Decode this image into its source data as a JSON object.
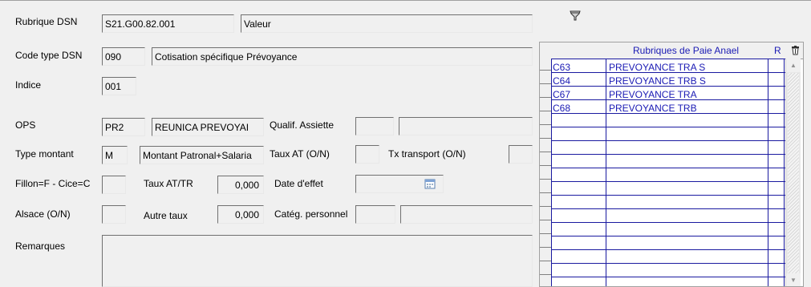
{
  "form": {
    "rubrique_dsn_label": "Rubrique DSN",
    "rubrique_dsn_value": "S21.G00.82.001",
    "valeur_value": "Valeur",
    "code_type_label": "Code type DSN",
    "code_type_value": "090",
    "code_type_desc": "Cotisation spécifique Prévoyance",
    "indice_label": "Indice",
    "indice_value": "001",
    "ops_label": "OPS",
    "ops_value": "PR2",
    "ops_desc": "REUNICA PREVOYAI",
    "qualif_label": "Qualif. Assiette",
    "qualif_value": "",
    "qualif_desc": "",
    "type_montant_label": "Type montant",
    "type_montant_value": "M",
    "type_montant_desc": "Montant Patronal+Salaria",
    "taux_at_label": "Taux AT (O/N)",
    "taux_at_value": "",
    "tx_transport_label": "Tx transport (O/N)",
    "tx_transport_value": "",
    "fillon_label": "Fillon=F - Cice=C",
    "fillon_value": "",
    "taux_at_tr_label": "Taux AT/TR",
    "taux_at_tr_value": "0,000",
    "date_effet_label": "Date d'effet",
    "date_effet_value": "",
    "alsace_label": "Alsace (O/N)",
    "alsace_value": "",
    "autre_taux_label": "Autre taux",
    "autre_taux_value": "0,000",
    "categ_label": "Catég. personnel",
    "categ_value": "",
    "categ_desc": "",
    "remarques_label": "Remarques",
    "remarques_value": ""
  },
  "grid": {
    "header_title": "Rubriques de Paie Anael",
    "header_r": "R",
    "rows": [
      {
        "code": "C63",
        "label": "PREVOYANCE TRA S"
      },
      {
        "code": "C64",
        "label": "PREVOYANCE TRB S"
      },
      {
        "code": "C67",
        "label": "PREVOYANCE TRA"
      },
      {
        "code": "C68",
        "label": "PREVOYANCE TRB"
      }
    ]
  },
  "icons": {
    "toolbar": "funnel-icon",
    "delete": "trash-icon",
    "calendar": "calendar-icon"
  }
}
